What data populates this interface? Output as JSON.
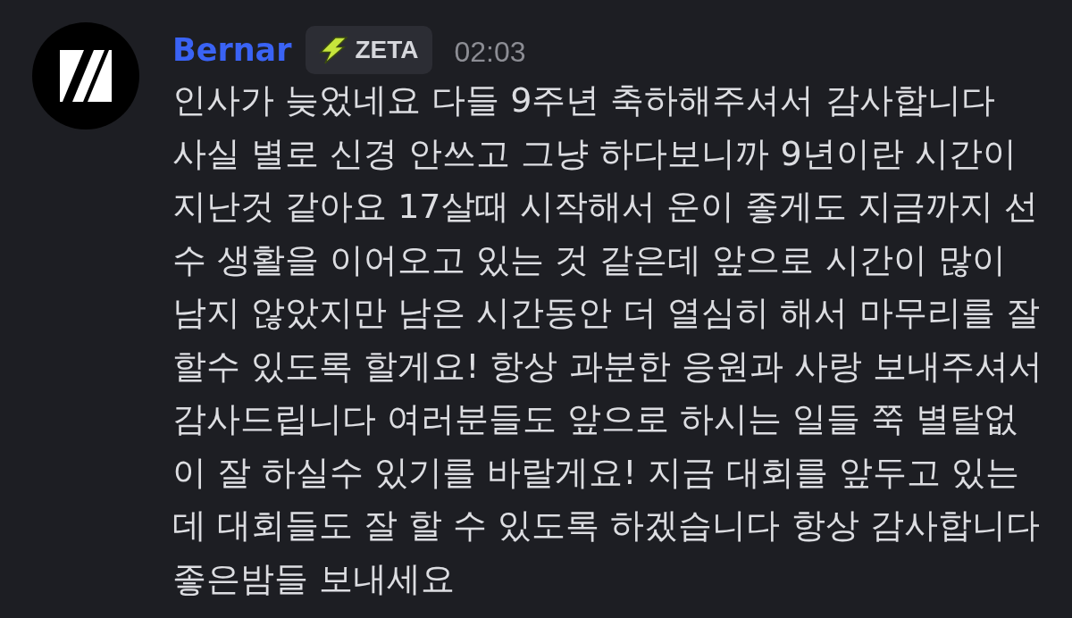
{
  "message": {
    "author": "Bernar",
    "tag": {
      "label": "ZETA"
    },
    "time": "02:03",
    "text_lines": [
      "인사가 늦었네요 다들 9주년 축하해주셔서 감사합니다",
      "사실 별로 신경 안쓰고 그냥 하다보니까 9년이란 시간이",
      "지난것 같아요 17살때 시작해서 운이 좋게도 지금까지 선",
      "수 생활을 이어오고 있는 것 같은데 앞으로 시간이 많이",
      "남지 않았지만 남은 시간동안 더 열심히 해서 마무리를 잘",
      "할수 있도록 할게요! 항상 과분한 응원과 사랑 보내주셔서",
      "감사드립니다 여러분들도 앞으로 하시는 일들 쭉 별탈없",
      "이 잘 하실수 있기를 바랄게요! 지금 대회를 앞두고 있는",
      "데 대회들도 잘 할 수 있도록 하겠습니다 항상 감사합니다",
      "좋은밤들 보내세요"
    ]
  }
}
